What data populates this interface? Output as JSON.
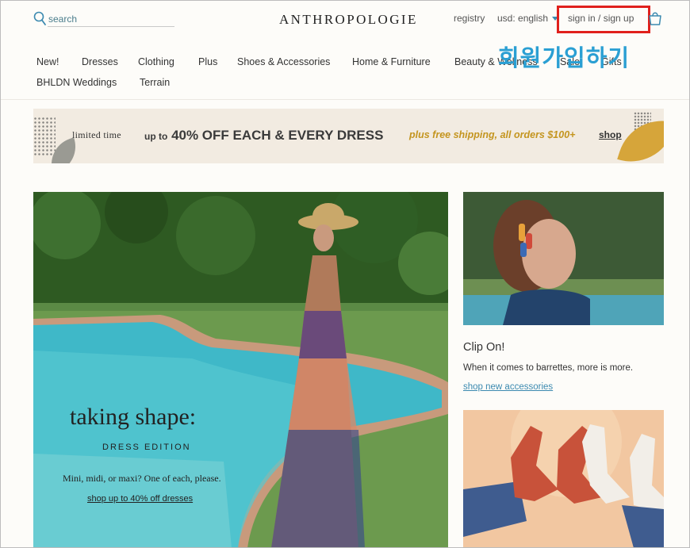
{
  "header": {
    "search_placeholder": "search",
    "logo": "ANTHROPOLOGIE",
    "registry": "registry",
    "currency": "usd: english",
    "sign_in": "sign in / sign up",
    "annotation": "회원가입하기"
  },
  "nav": {
    "items": [
      "New!",
      "Dresses",
      "Clothing",
      "Plus",
      "Shoes & Accessories",
      "Home & Furniture",
      "Beauty & Wellness",
      "Sale",
      "Gifts",
      "BHLDN Weddings",
      "Terrain"
    ]
  },
  "promo": {
    "limited": "limited time",
    "main_prefix": "up to",
    "main": "40% OFF EACH & EVERY DRESS",
    "shipping_italic": "plus free shipping,",
    "shipping": "all orders $100+",
    "shop": "shop"
  },
  "hero": {
    "title": "taking shape:",
    "subtitle": "DRESS EDITION",
    "description": "Mini, midi, or maxi? One of each, please.",
    "link": "shop up to 40% off dresses"
  },
  "feature": {
    "title": "Clip On!",
    "description": "When it comes to barrettes, more is more.",
    "link": "shop new accessories"
  },
  "colors": {
    "accent_blue": "#3c8ab0",
    "promo_gold": "#c4951f",
    "highlight_red": "#e0201c",
    "annotation_blue": "#2a9fd3"
  }
}
